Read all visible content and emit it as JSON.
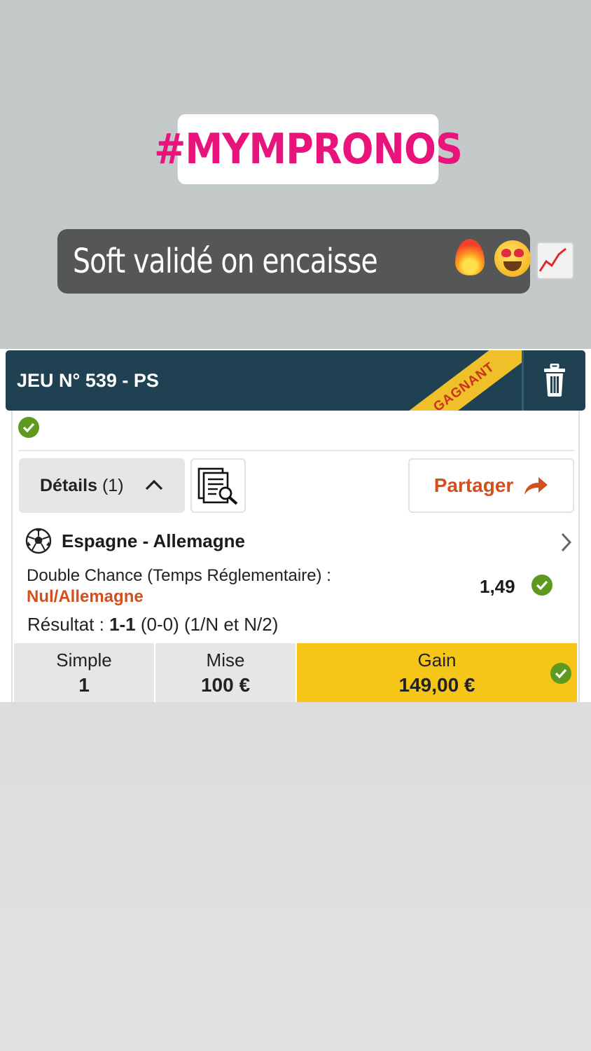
{
  "story": {
    "hashtag": "#MYMPRONOS",
    "caption": "Soft validé on encaisse",
    "emojis": [
      "fire-emoji",
      "heart-eyes-emoji",
      "chart-increasing-emoji"
    ]
  },
  "bet_card": {
    "title": "JEU N° 539 - PS",
    "status_ribbon": "GAGNANT",
    "details_label": "Détails",
    "details_count": "(1)",
    "share_label": "Partager",
    "match": {
      "name": "Espagne - Allemagne",
      "market": "Double Chance (Temps Réglementaire) :",
      "selection": "Nul/Allemagne",
      "odds": "1,49",
      "result_label": "Résultat :",
      "result_score": "1-1",
      "result_detail": "(0-0) (1/N et N/2)"
    },
    "summary": {
      "type_label": "Simple",
      "type_value": "1",
      "stake_label": "Mise",
      "stake_value": "100 €",
      "gain_label": "Gain",
      "gain_value": "149,00 €"
    }
  },
  "colors": {
    "hashtag": "#e8137b",
    "header_bg": "#1f4152",
    "ribbon": "#f0c02a",
    "accent_orange": "#d2501e",
    "success_green": "#5e9a1f",
    "gain_bg": "#f5c518"
  }
}
